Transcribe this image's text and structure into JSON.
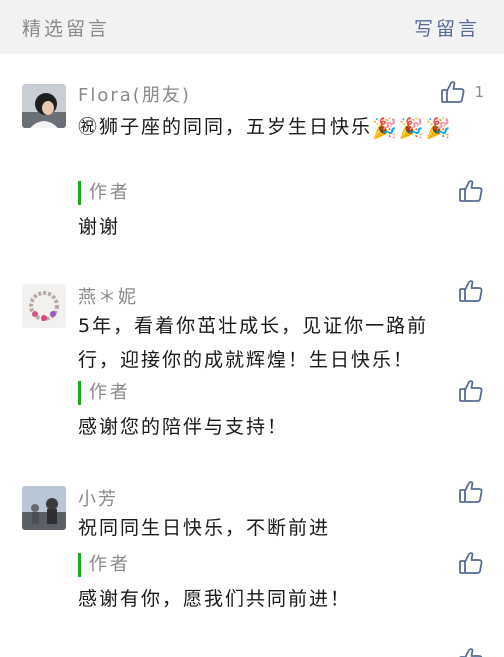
{
  "header": {
    "title": "精选留言",
    "write_label": "写留言"
  },
  "comments": [
    {
      "nickname": "Flora(朋友)",
      "like_count": "1",
      "text_before": "㊗狮子座的同同，五岁生日快乐",
      "emoji": "🎉",
      "reply_label": "作者",
      "reply_text": "谢谢"
    },
    {
      "nickname": "燕＊妮",
      "text": "5年，看着你茁壮成长，见证你一路前行，迎接你的成就辉煌！生日快乐！",
      "reply_label": "作者",
      "reply_text": "感谢您的陪伴与支持！"
    },
    {
      "nickname": "小芳",
      "text": "祝同同生日快乐，不断前进",
      "reply_label": "作者",
      "reply_text": "感谢有你，愿我们共同前进！"
    },
    {
      "nickname": "",
      "partial": true
    }
  ],
  "icons": {
    "like": "thumbs-up-icon",
    "reply_like": "thumbs-up-icon",
    "emoji": "party-popper-icon"
  },
  "colors": {
    "header_bg": "#f2f2f2",
    "link": "#576b95",
    "muted": "#8a8a8a",
    "reply_bar": "#1aad19"
  }
}
